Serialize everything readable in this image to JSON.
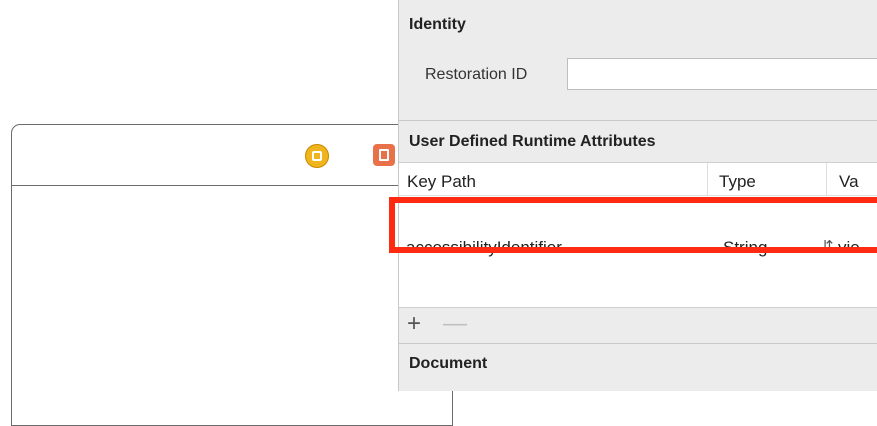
{
  "inspector": {
    "identity": {
      "title": "Identity",
      "restoration_id_label": "Restoration ID",
      "restoration_id_value": ""
    },
    "user_defined_runtime_attributes": {
      "title": "User Defined Runtime Attributes",
      "columns": [
        "Key Path",
        "Type",
        "Va"
      ],
      "rows": [
        {
          "key_path": "accessibilityIdentifier",
          "type": "String",
          "value": "vie"
        }
      ],
      "add_label": "+",
      "remove_label": "—"
    },
    "document": {
      "title": "Document"
    }
  },
  "canvas": {
    "icons": [
      "view-controller-icon",
      "first-responder-icon"
    ]
  },
  "highlight_color": "#ff2a12"
}
